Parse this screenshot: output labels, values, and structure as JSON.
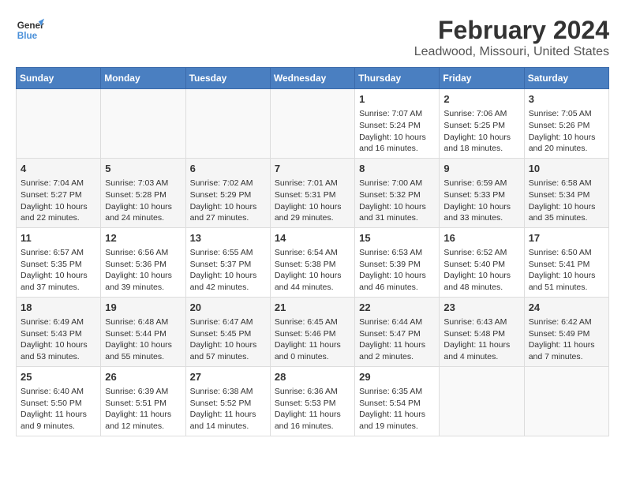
{
  "header": {
    "logo_line1": "General",
    "logo_line2": "Blue",
    "title": "February 2024",
    "subtitle": "Leadwood, Missouri, United States"
  },
  "weekdays": [
    "Sunday",
    "Monday",
    "Tuesday",
    "Wednesday",
    "Thursday",
    "Friday",
    "Saturday"
  ],
  "weeks": [
    [
      {
        "day": "",
        "info": ""
      },
      {
        "day": "",
        "info": ""
      },
      {
        "day": "",
        "info": ""
      },
      {
        "day": "",
        "info": ""
      },
      {
        "day": "1",
        "info": "Sunrise: 7:07 AM\nSunset: 5:24 PM\nDaylight: 10 hours\nand 16 minutes."
      },
      {
        "day": "2",
        "info": "Sunrise: 7:06 AM\nSunset: 5:25 PM\nDaylight: 10 hours\nand 18 minutes."
      },
      {
        "day": "3",
        "info": "Sunrise: 7:05 AM\nSunset: 5:26 PM\nDaylight: 10 hours\nand 20 minutes."
      }
    ],
    [
      {
        "day": "4",
        "info": "Sunrise: 7:04 AM\nSunset: 5:27 PM\nDaylight: 10 hours\nand 22 minutes."
      },
      {
        "day": "5",
        "info": "Sunrise: 7:03 AM\nSunset: 5:28 PM\nDaylight: 10 hours\nand 24 minutes."
      },
      {
        "day": "6",
        "info": "Sunrise: 7:02 AM\nSunset: 5:29 PM\nDaylight: 10 hours\nand 27 minutes."
      },
      {
        "day": "7",
        "info": "Sunrise: 7:01 AM\nSunset: 5:31 PM\nDaylight: 10 hours\nand 29 minutes."
      },
      {
        "day": "8",
        "info": "Sunrise: 7:00 AM\nSunset: 5:32 PM\nDaylight: 10 hours\nand 31 minutes."
      },
      {
        "day": "9",
        "info": "Sunrise: 6:59 AM\nSunset: 5:33 PM\nDaylight: 10 hours\nand 33 minutes."
      },
      {
        "day": "10",
        "info": "Sunrise: 6:58 AM\nSunset: 5:34 PM\nDaylight: 10 hours\nand 35 minutes."
      }
    ],
    [
      {
        "day": "11",
        "info": "Sunrise: 6:57 AM\nSunset: 5:35 PM\nDaylight: 10 hours\nand 37 minutes."
      },
      {
        "day": "12",
        "info": "Sunrise: 6:56 AM\nSunset: 5:36 PM\nDaylight: 10 hours\nand 39 minutes."
      },
      {
        "day": "13",
        "info": "Sunrise: 6:55 AM\nSunset: 5:37 PM\nDaylight: 10 hours\nand 42 minutes."
      },
      {
        "day": "14",
        "info": "Sunrise: 6:54 AM\nSunset: 5:38 PM\nDaylight: 10 hours\nand 44 minutes."
      },
      {
        "day": "15",
        "info": "Sunrise: 6:53 AM\nSunset: 5:39 PM\nDaylight: 10 hours\nand 46 minutes."
      },
      {
        "day": "16",
        "info": "Sunrise: 6:52 AM\nSunset: 5:40 PM\nDaylight: 10 hours\nand 48 minutes."
      },
      {
        "day": "17",
        "info": "Sunrise: 6:50 AM\nSunset: 5:41 PM\nDaylight: 10 hours\nand 51 minutes."
      }
    ],
    [
      {
        "day": "18",
        "info": "Sunrise: 6:49 AM\nSunset: 5:43 PM\nDaylight: 10 hours\nand 53 minutes."
      },
      {
        "day": "19",
        "info": "Sunrise: 6:48 AM\nSunset: 5:44 PM\nDaylight: 10 hours\nand 55 minutes."
      },
      {
        "day": "20",
        "info": "Sunrise: 6:47 AM\nSunset: 5:45 PM\nDaylight: 10 hours\nand 57 minutes."
      },
      {
        "day": "21",
        "info": "Sunrise: 6:45 AM\nSunset: 5:46 PM\nDaylight: 11 hours\nand 0 minutes."
      },
      {
        "day": "22",
        "info": "Sunrise: 6:44 AM\nSunset: 5:47 PM\nDaylight: 11 hours\nand 2 minutes."
      },
      {
        "day": "23",
        "info": "Sunrise: 6:43 AM\nSunset: 5:48 PM\nDaylight: 11 hours\nand 4 minutes."
      },
      {
        "day": "24",
        "info": "Sunrise: 6:42 AM\nSunset: 5:49 PM\nDaylight: 11 hours\nand 7 minutes."
      }
    ],
    [
      {
        "day": "25",
        "info": "Sunrise: 6:40 AM\nSunset: 5:50 PM\nDaylight: 11 hours\nand 9 minutes."
      },
      {
        "day": "26",
        "info": "Sunrise: 6:39 AM\nSunset: 5:51 PM\nDaylight: 11 hours\nand 12 minutes."
      },
      {
        "day": "27",
        "info": "Sunrise: 6:38 AM\nSunset: 5:52 PM\nDaylight: 11 hours\nand 14 minutes."
      },
      {
        "day": "28",
        "info": "Sunrise: 6:36 AM\nSunset: 5:53 PM\nDaylight: 11 hours\nand 16 minutes."
      },
      {
        "day": "29",
        "info": "Sunrise: 6:35 AM\nSunset: 5:54 PM\nDaylight: 11 hours\nand 19 minutes."
      },
      {
        "day": "",
        "info": ""
      },
      {
        "day": "",
        "info": ""
      }
    ]
  ]
}
